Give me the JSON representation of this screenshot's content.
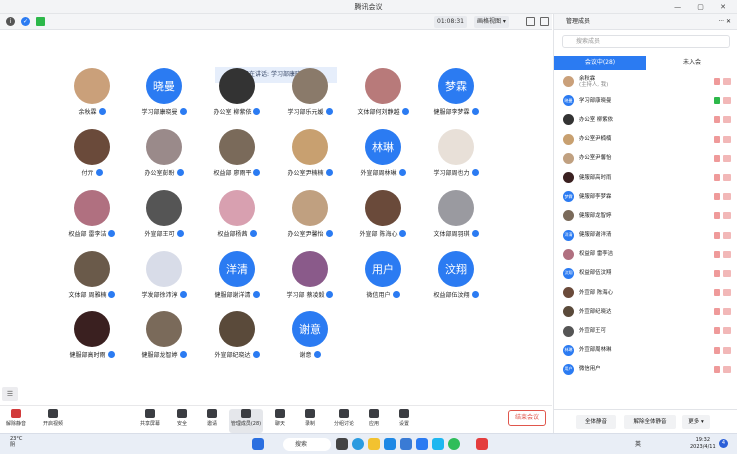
{
  "window": {
    "title": "腾讯会议"
  },
  "toolbar": {
    "duration": "01:08:31",
    "view_label": "画格视图"
  },
  "speaker": {
    "text": "正在讲话: 学习部康晓曼;"
  },
  "colors": {
    "accent": "#2b7bf2",
    "end": "#e0564c"
  },
  "tiles": [
    {
      "name": "余秋霖",
      "avatar": "",
      "color": "#caa07a"
    },
    {
      "name": "学习部康晓曼",
      "avatar": "晓曼",
      "color": "#2b7bf2"
    },
    {
      "name": "办公室 柳紫依",
      "avatar": "",
      "color": "#333"
    },
    {
      "name": "学习部乐元媛",
      "avatar": "",
      "color": "#8a7a6a"
    },
    {
      "name": "文体部何刘静越",
      "avatar": "",
      "color": "#b87a7a"
    },
    {
      "name": "健服部李梦霖",
      "avatar": "梦霖",
      "color": "#2b7bf2"
    },
    {
      "name": "付亓",
      "avatar": "",
      "color": "#6a4a3a"
    },
    {
      "name": "办公室彭盼",
      "avatar": "",
      "color": "#9a8a8a"
    },
    {
      "name": "权益部 廖雨平",
      "avatar": "",
      "color": "#7a6a5a"
    },
    {
      "name": "办公室尹楠楠",
      "avatar": "",
      "color": "#c8a070"
    },
    {
      "name": "外宣部周林琳",
      "avatar": "林琳",
      "color": "#2b7bf2"
    },
    {
      "name": "学习部周也力",
      "avatar": "",
      "color": "#e8e0d8"
    },
    {
      "name": "权益部 雷李洁",
      "avatar": "",
      "color": "#b07080"
    },
    {
      "name": "外宣部王可",
      "avatar": "",
      "color": "#555"
    },
    {
      "name": "权益部杨茜",
      "avatar": "",
      "color": "#d8a0b0"
    },
    {
      "name": "办公室尹馨怡",
      "avatar": "",
      "color": "#c0a080"
    },
    {
      "name": "外宣部 陈海心",
      "avatar": "",
      "color": "#6a4a3a"
    },
    {
      "name": "文体部周羽琪",
      "avatar": "",
      "color": "#9a9aa0"
    },
    {
      "name": "文体部 周雅楠",
      "avatar": "",
      "color": "#6a5a4a"
    },
    {
      "name": "学发部徐沛淳",
      "avatar": "",
      "color": "#d8dce8"
    },
    {
      "name": "健服部谢洋清",
      "avatar": "洋清",
      "color": "#2b7bf2"
    },
    {
      "name": "学习部 蔡凌毅",
      "avatar": "",
      "color": "#8a5a8a"
    },
    {
      "name": "微信用户",
      "avatar": "用户",
      "color": "#2b7bf2"
    },
    {
      "name": "权益部伍汶翔",
      "avatar": "汶翔",
      "color": "#2b7bf2"
    },
    {
      "name": "健服部高时雨",
      "avatar": "",
      "color": "#3a2020"
    },
    {
      "name": "健服部龙智婷",
      "avatar": "",
      "color": "#7a6a5a"
    },
    {
      "name": "外宣部纪晓达",
      "avatar": "",
      "color": "#5a4a3a"
    },
    {
      "name": "谢意",
      "avatar": "谢意",
      "color": "#2b7bf2"
    }
  ],
  "bottombar": {
    "items": [
      "解除静音",
      "开启视频",
      "共享屏幕",
      "安全",
      "邀请",
      "管理成员(28)",
      "聊天",
      "录制",
      "分组讨论",
      "应用",
      "设置"
    ],
    "end": "结束会议"
  },
  "panel": {
    "title": "管理成员",
    "search_placeholder": "搜索成员",
    "tab_in": "会议中(28)",
    "tab_out": "未入会",
    "members": [
      {
        "name": "余秋霖",
        "role": "(主持人, 我)",
        "avatar": "",
        "color": "#caa07a"
      },
      {
        "name": "学习部康晓曼",
        "role": "",
        "avatar": "晓曼",
        "color": "#2b7bf2"
      },
      {
        "name": "办公室 柳紫依",
        "role": "",
        "avatar": "",
        "color": "#333"
      },
      {
        "name": "办公室尹楠楠",
        "role": "",
        "avatar": "",
        "color": "#c8a070"
      },
      {
        "name": "办公室尹馨怡",
        "role": "",
        "avatar": "",
        "color": "#c0a080"
      },
      {
        "name": "健服部高时雨",
        "role": "",
        "avatar": "",
        "color": "#3a2020"
      },
      {
        "name": "健服部李梦霖",
        "role": "",
        "avatar": "梦霖",
        "color": "#2b7bf2"
      },
      {
        "name": "健服部龙智婷",
        "role": "",
        "avatar": "",
        "color": "#7a6a5a"
      },
      {
        "name": "健服部谢洋清",
        "role": "",
        "avatar": "洋清",
        "color": "#2b7bf2"
      },
      {
        "name": "权益部 雷李洁",
        "role": "",
        "avatar": "",
        "color": "#b07080"
      },
      {
        "name": "权益部伍汶翔",
        "role": "",
        "avatar": "汶翔",
        "color": "#2b7bf2"
      },
      {
        "name": "外宣部 陈海心",
        "role": "",
        "avatar": "",
        "color": "#6a4a3a"
      },
      {
        "name": "外宣部纪晓达",
        "role": "",
        "avatar": "",
        "color": "#5a4a3a"
      },
      {
        "name": "外宣部王可",
        "role": "",
        "avatar": "",
        "color": "#555"
      },
      {
        "name": "外宣部周林琳",
        "role": "",
        "avatar": "林琳",
        "color": "#2b7bf2"
      },
      {
        "name": "微信用户",
        "role": "",
        "avatar": "用户",
        "color": "#2b7bf2"
      }
    ],
    "btn_mute_all": "全体静音",
    "btn_unmute_all": "解除全体静音",
    "btn_more": "更多 ▾"
  },
  "taskbar": {
    "temp": "23°C",
    "weather": "阴",
    "search": "搜索",
    "ime": "英",
    "time": "19:32",
    "date": "2023/4/11",
    "notif": "4"
  }
}
